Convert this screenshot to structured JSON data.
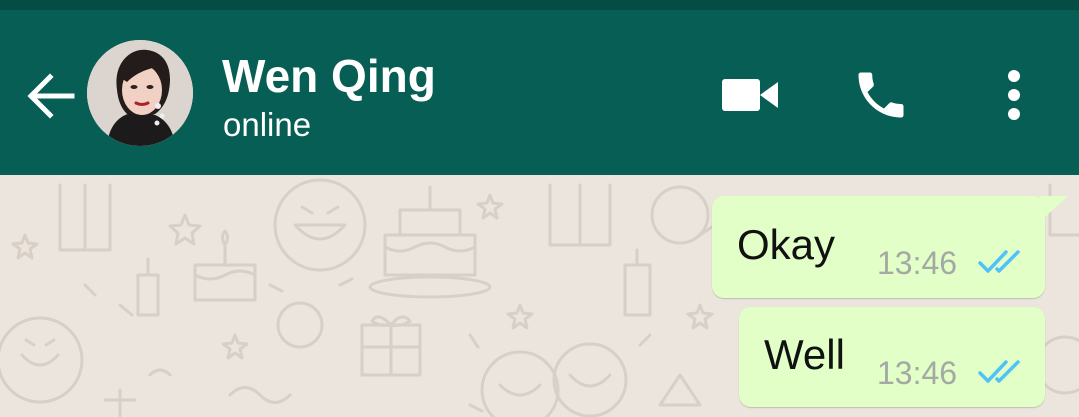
{
  "header": {
    "contact_name": "Wen Qing",
    "contact_status": "online",
    "back_icon": "arrow-left-icon",
    "video_icon": "video-camera-icon",
    "call_icon": "phone-icon",
    "menu_icon": "more-vertical-icon"
  },
  "messages": [
    {
      "text": "Okay",
      "time": "13:46",
      "direction": "outgoing",
      "status": "read"
    },
    {
      "text": "Well",
      "time": "13:46",
      "direction": "outgoing",
      "status": "read"
    }
  ],
  "colors": {
    "header": "#075e54",
    "status_bar": "#054d44",
    "chat_background": "#ece5dd",
    "outgoing_bubble": "#e1ffc7",
    "read_ticks": "#4fc3f7",
    "timestamp": "#a4a9a4"
  }
}
